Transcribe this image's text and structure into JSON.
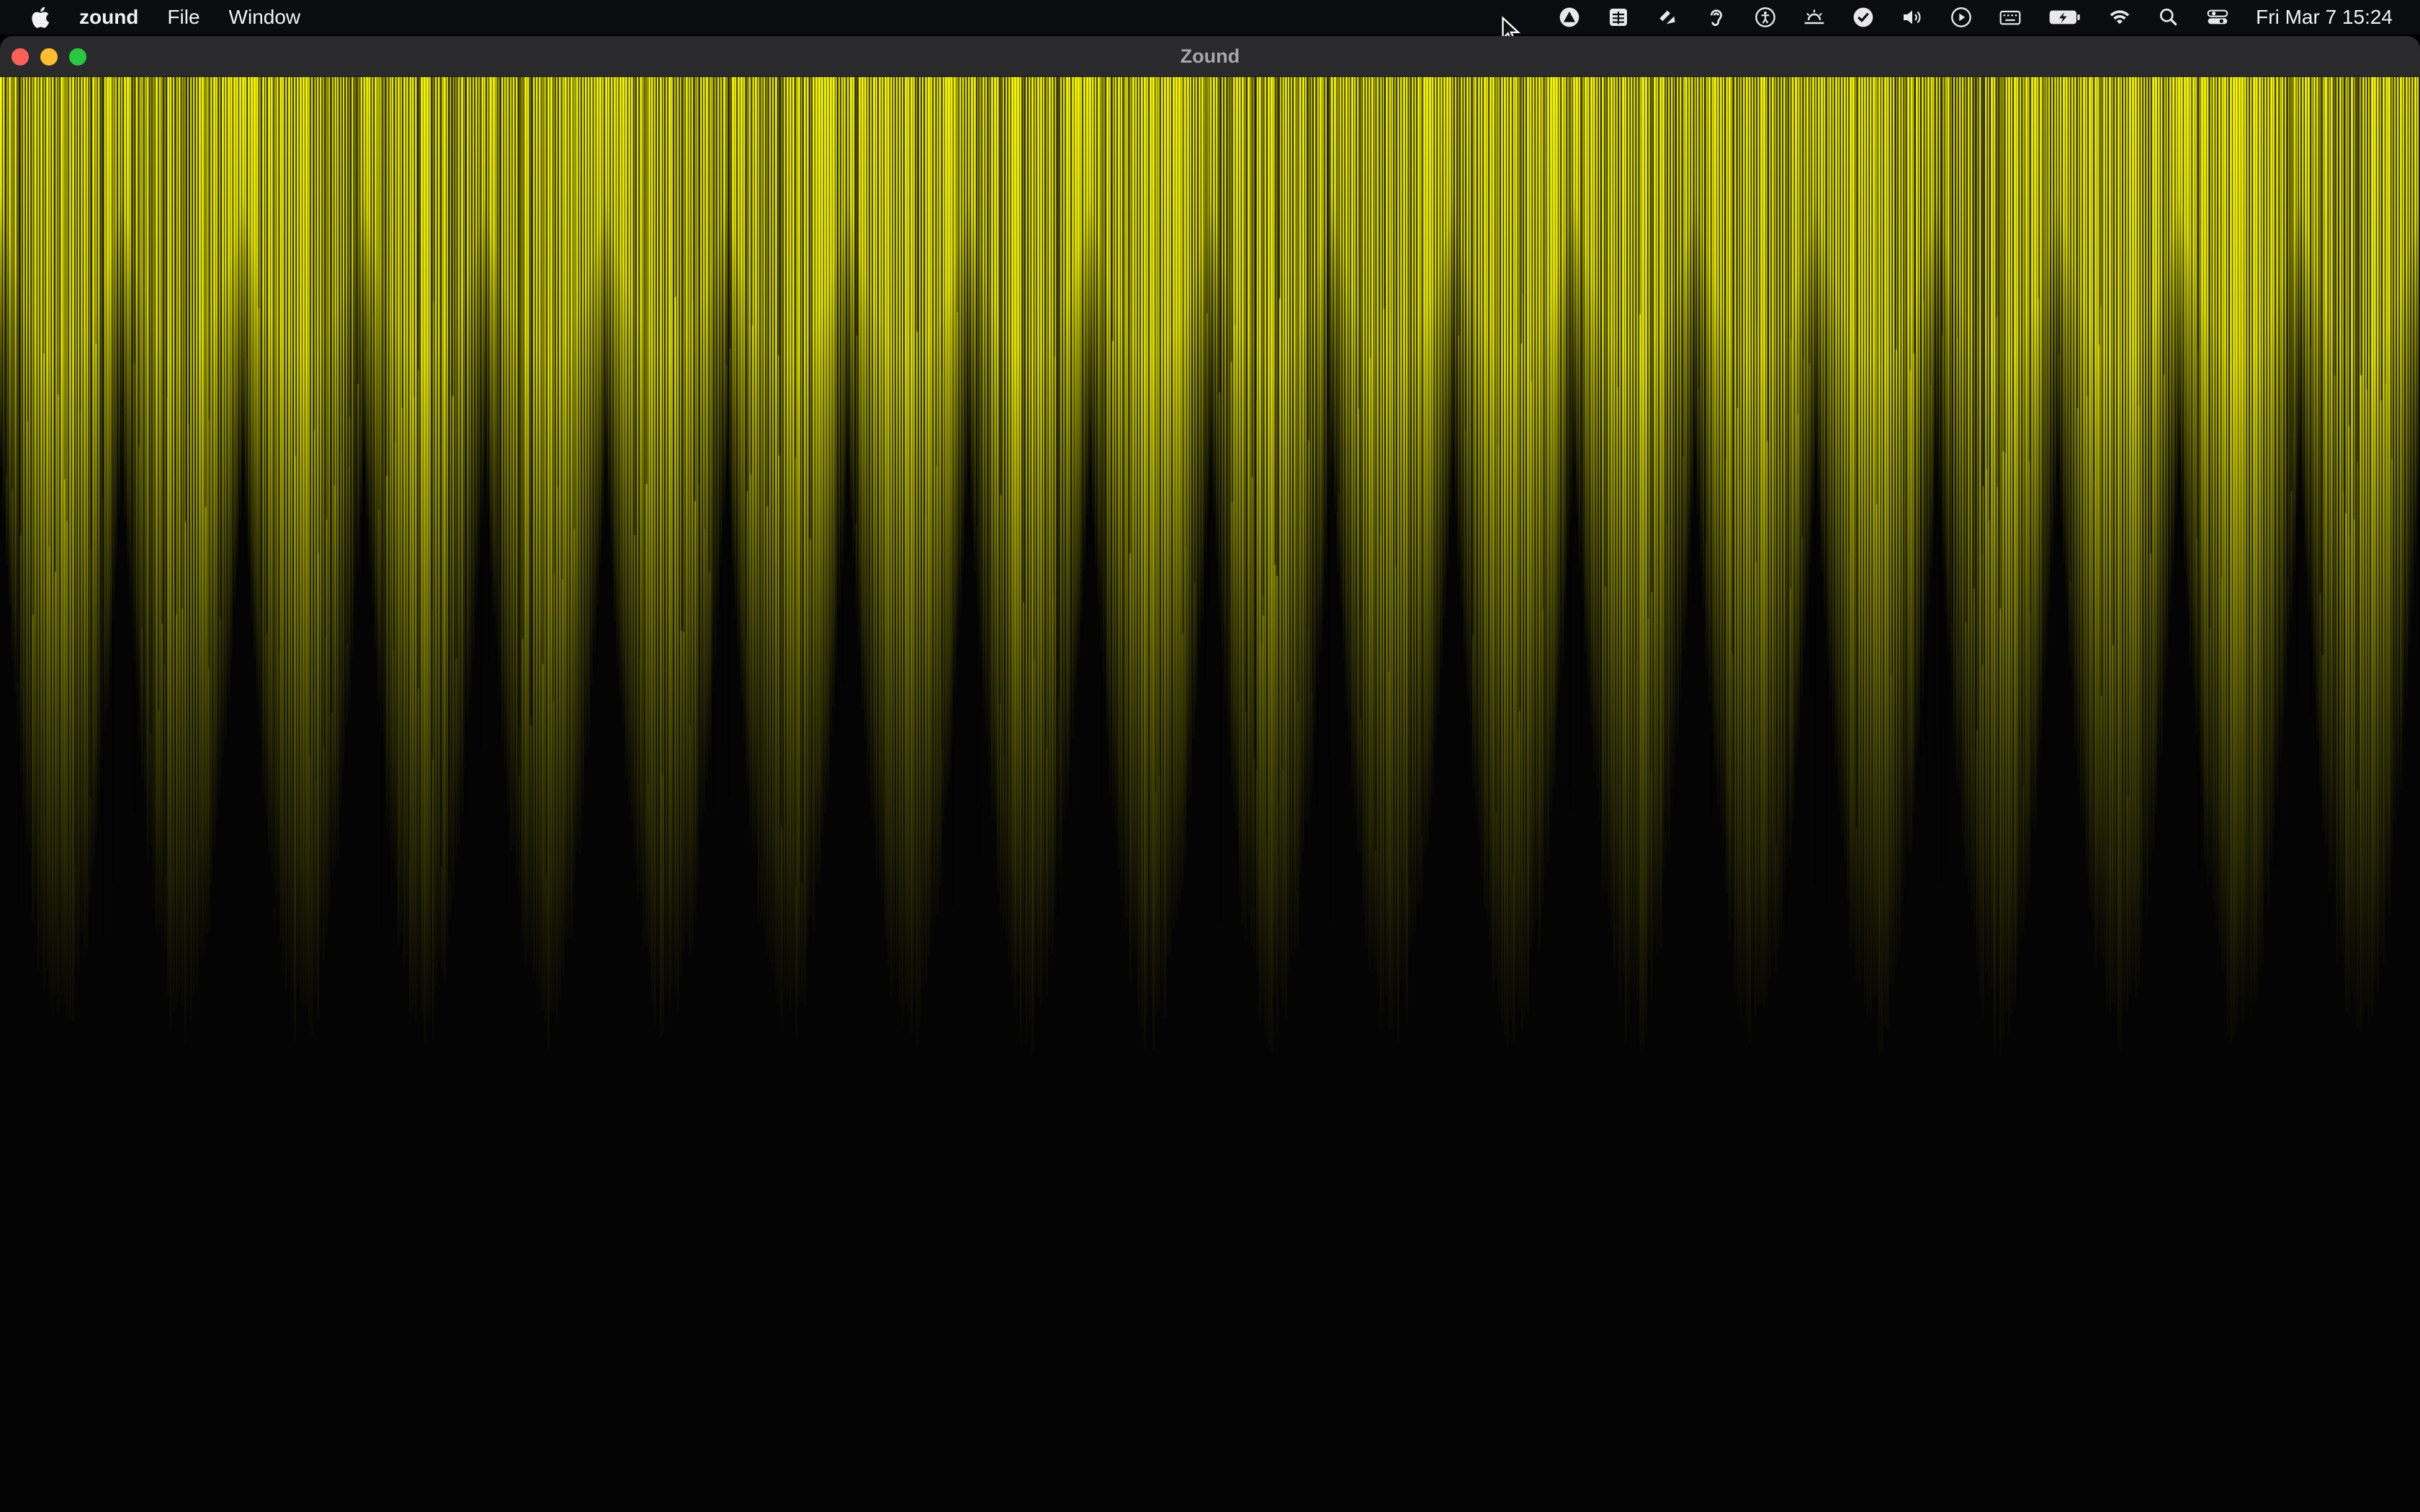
{
  "menubar": {
    "apple_icon": "apple-logo-icon",
    "app_name": "zound",
    "menus": [
      "File",
      "Window"
    ],
    "status_icons": [
      "alert-triangle-icon",
      "grid-window-icon",
      "dropbox-icon",
      "ear-icon",
      "accessibility-icon",
      "sunrise-icon",
      "checkmark-circle-icon",
      "volume-icon",
      "play-circle-icon",
      "keyboard-icon",
      "battery-charging-icon",
      "wifi-icon",
      "search-icon",
      "control-center-icon"
    ],
    "clock": "Fri Mar 7  15:24"
  },
  "window": {
    "title": "Zound"
  },
  "visualizer": {
    "colors": {
      "bar": "#ffff00",
      "background": "#040405"
    }
  }
}
